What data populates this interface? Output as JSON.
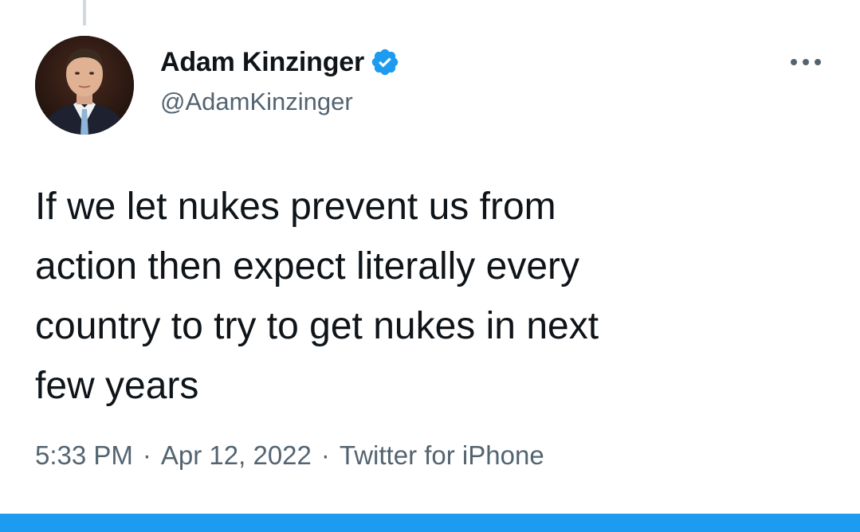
{
  "author": {
    "display_name": "Adam Kinzinger",
    "handle": "@AdamKinzinger",
    "verified": true,
    "avatar_icon": "profile-photo"
  },
  "tweet": {
    "text": "If we let nukes prevent us from\naction then expect literally every\ncountry to try to get nukes in next\nfew years",
    "time": "5:33 PM",
    "separator": "·",
    "date": "Apr 12, 2022",
    "source": "Twitter for iPhone"
  },
  "icons": {
    "verified": "verified-badge-icon",
    "more": "more-options-icon"
  },
  "colors": {
    "text": "#0f1419",
    "secondary": "#536471",
    "accent": "#1d9bf0",
    "thread_line": "#cfd9de"
  }
}
